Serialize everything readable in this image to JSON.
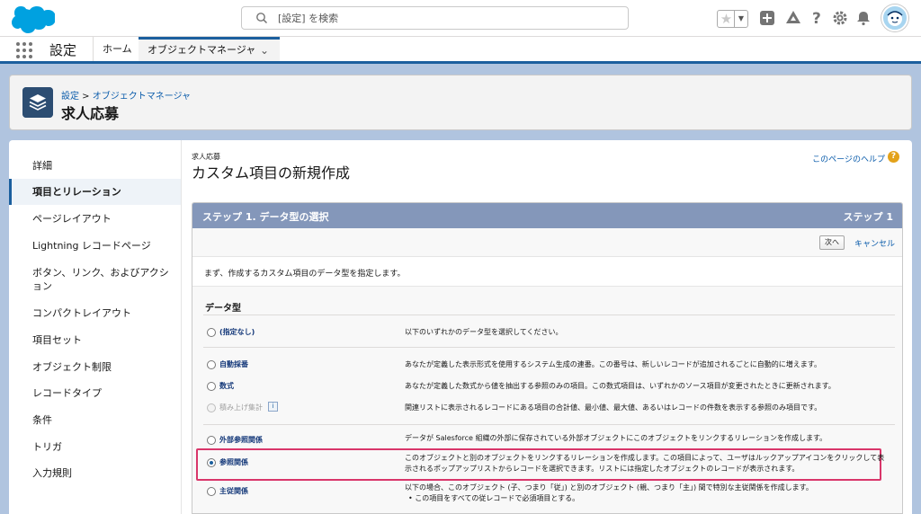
{
  "header": {
    "search_placeholder": "[設定] を検索",
    "icons": [
      "salesforce-cloud-logo",
      "search-icon",
      "favorite-star-icon",
      "add-icon",
      "trailhead-icon",
      "help-icon",
      "setup-gear-icon",
      "notification-bell-icon",
      "user-avatar"
    ]
  },
  "nav": {
    "app_name": "設定",
    "tabs": [
      {
        "label": "ホーム"
      },
      {
        "label": "オブジェクトマネージャ"
      }
    ]
  },
  "page_header": {
    "breadcrumb_root": "設定",
    "breadcrumb_sep": " > ",
    "breadcrumb_child": "オブジェクトマネージャ",
    "title": "求人応募"
  },
  "sidebar": {
    "items": [
      {
        "label": "詳細"
      },
      {
        "label": "項目とリレーション"
      },
      {
        "label": "ページレイアウト"
      },
      {
        "label": "Lightning レコードページ"
      },
      {
        "label": "ボタン、リンク、およびアクション"
      },
      {
        "label": "コンパクトレイアウト"
      },
      {
        "label": "項目セット"
      },
      {
        "label": "オブジェクト制限"
      },
      {
        "label": "レコードタイプ"
      },
      {
        "label": "条件"
      },
      {
        "label": "トリガ"
      },
      {
        "label": "入力規則"
      }
    ],
    "active_index": 1
  },
  "main": {
    "object_name": "求人応募",
    "title": "カスタム項目の新規作成",
    "help_link": "このページのヘルプ",
    "step_title": "ステップ 1. データ型の選択",
    "step_number": "ステップ 1",
    "next_button": "次へ",
    "cancel_link": "キャンセル",
    "intro": "まず、作成するカスタム項目のデータ型を指定します。",
    "data_type_heading": "データ型",
    "options": [
      {
        "label": "(指定なし)",
        "desc": "以下のいずれかのデータ型を選択してください。",
        "checked": false,
        "disabled": false
      },
      {
        "label": "自動採番",
        "desc": "あなたが定義した表示形式を使用するシステム生成の連番。この番号は、新しいレコードが追加されるごとに自動的に増えます。",
        "checked": false,
        "disabled": false
      },
      {
        "label": "数式",
        "desc": "あなたが定義した数式から値を抽出する参照のみの項目。この数式項目は、いずれかのソース項目が変更されたときに更新されます。",
        "checked": false,
        "disabled": false
      },
      {
        "label": "積み上げ集計",
        "desc": "関連リストに表示されるレコードにある項目の合計値、最小値、最大値、あるいはレコードの件数を表示する参照のみ項目です。",
        "checked": false,
        "disabled": true
      },
      {
        "label": "外部参照関係",
        "desc": "データが Salesforce 組織の外部に保存されている外部オブジェクトにこのオブジェクトをリンクするリレーションを作成します。",
        "checked": false,
        "disabled": false
      },
      {
        "label": "参照関係",
        "desc": "このオブジェクトと別のオブジェクトをリンクするリレーションを作成します。この項目によって、ユーザはルックアップアイコンをクリックして表示されるポップアップリストからレコードを選択できます。リストには指定したオブジェクトのレコードが表示されます。",
        "checked": true,
        "disabled": false
      },
      {
        "label": "主従関係",
        "desc": "以下の場合、このオブジェクト (子、つまり「従」) と別のオブジェクト (親、つまり「主」) 間で特別な主従関係を作成します。",
        "bullet": "この項目をすべての従レコードで必須項目とする。",
        "checked": false,
        "disabled": false
      }
    ]
  },
  "colors": {
    "brand_blue": "#1b5f9e",
    "step_header": "#8497ba",
    "highlight": "#d9366a",
    "link": "#0b5cab"
  }
}
